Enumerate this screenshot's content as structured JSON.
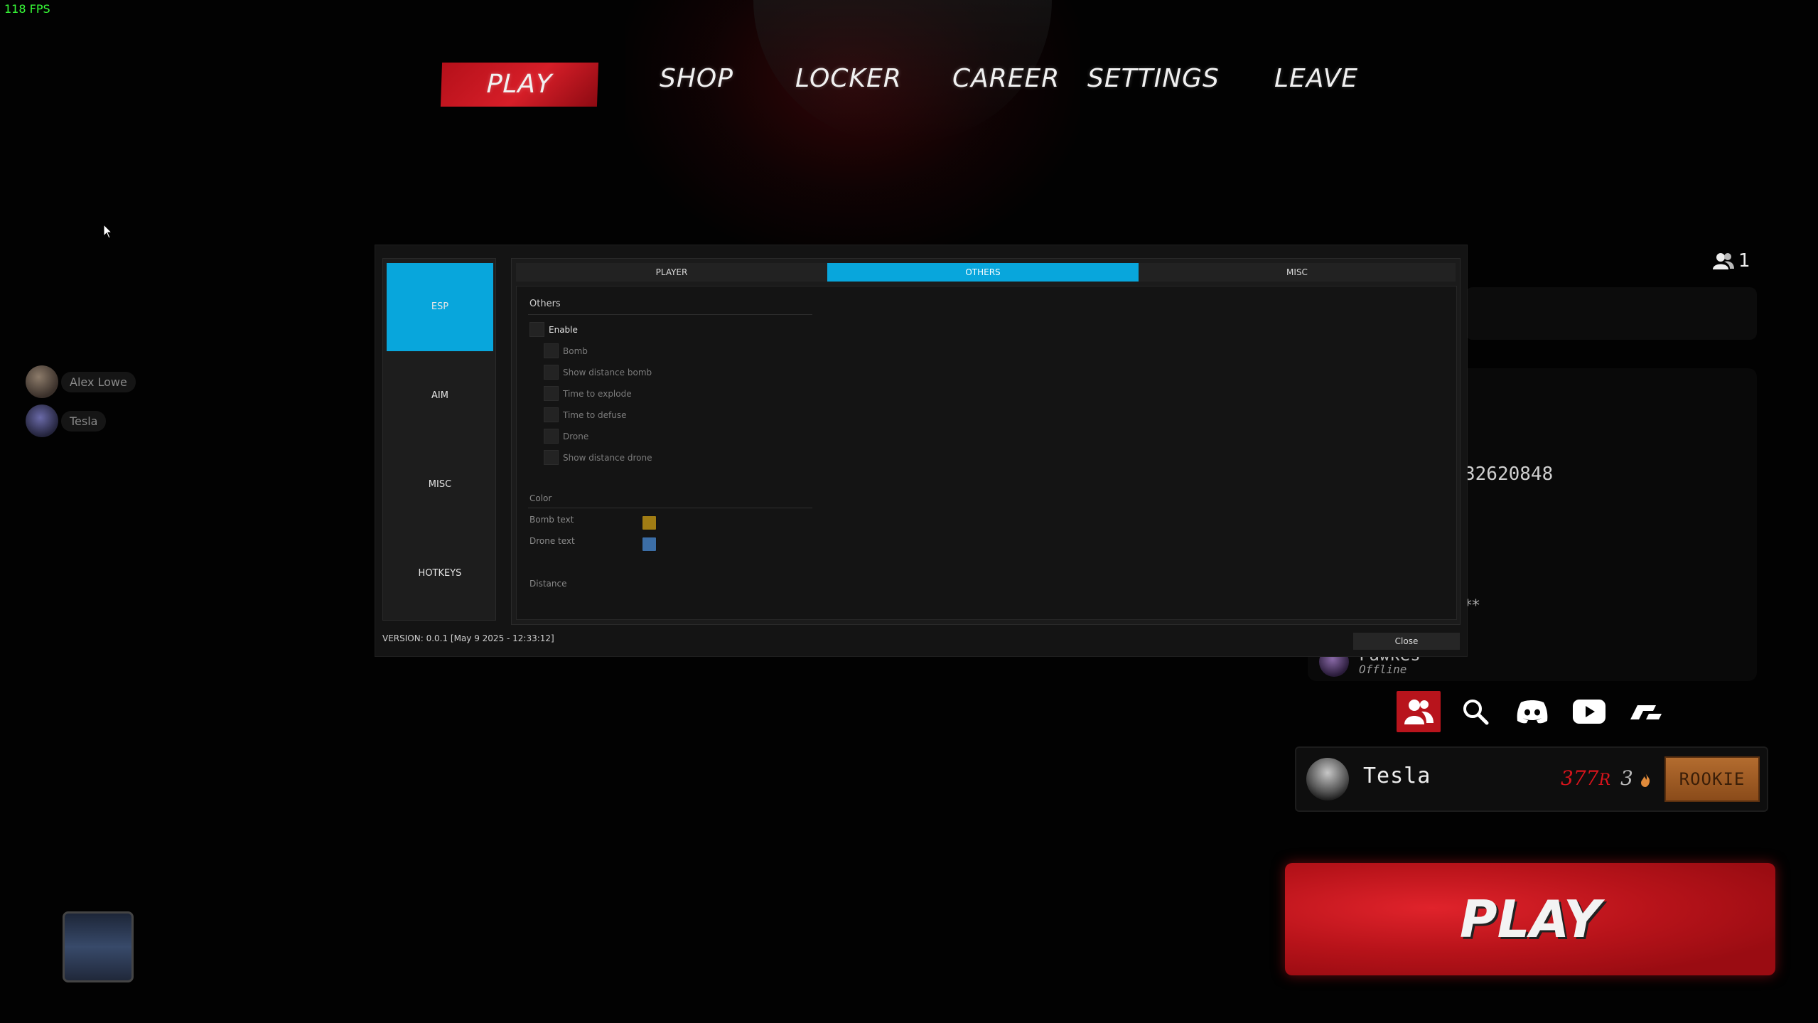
{
  "fps": "118 FPS",
  "nav": {
    "items": [
      "PLAY",
      "SHOP",
      "LOCKER",
      "CAREER",
      "SETTINGS",
      "LEAVE"
    ],
    "active": "PLAY",
    "active_color": "#d61e28"
  },
  "friends": [
    {
      "name": "Alex Lowe"
    },
    {
      "name": "Tesla"
    }
  ],
  "menu": {
    "sidebar": [
      "ESP",
      "AIM",
      "MISC",
      "HOTKEYS"
    ],
    "sidebar_active": "ESP",
    "tabs": [
      "PLAYER",
      "OTHERS",
      "MISC"
    ],
    "tab_active": "OTHERS",
    "accent": "#08a6dc",
    "others": {
      "title": "Others",
      "enable_label": "Enable",
      "options": [
        "Bomb",
        "Show distance bomb",
        "Time to explode",
        "Time to defuse",
        "Drone",
        "Show distance drone"
      ]
    },
    "color": {
      "title": "Color",
      "items": [
        {
          "label": "Bomb text",
          "color": "#a07c14"
        },
        {
          "label": "Drone text",
          "color": "#3c6ea6"
        }
      ]
    },
    "distance": {
      "title": "Distance"
    },
    "version": "VERSION: 0.0.1 [May  9 2025 - 12:33:12]",
    "close_label": "Close"
  },
  "party": {
    "count": "1",
    "id_partial": "32620848",
    "stars": "**",
    "friend": {
      "name": "Fawkes",
      "status": "Offline"
    }
  },
  "social": [
    "friends-icon",
    "search-icon",
    "discord-icon",
    "youtube-icon",
    "brand-icon"
  ],
  "player": {
    "name": "Tesla",
    "rp": "377",
    "rp_suffix": "R",
    "streak": "3",
    "rank": "ROOKIE"
  },
  "play_button": "PLAY"
}
